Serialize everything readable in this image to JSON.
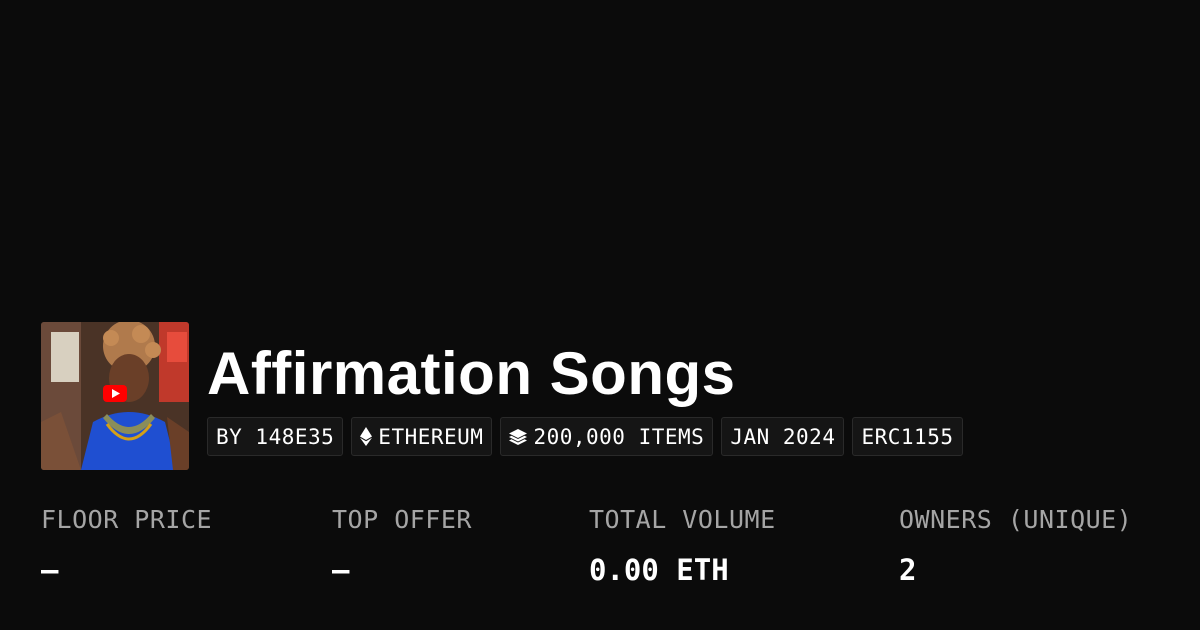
{
  "collection": {
    "title": "Affirmation Songs",
    "avatar_icon": "play-badge-icon",
    "tags": [
      {
        "label": "BY 148E35",
        "icon": null
      },
      {
        "label": "ETHEREUM",
        "icon": "ethereum-icon"
      },
      {
        "label": "200,000 ITEMS",
        "icon": "layers-icon"
      },
      {
        "label": "JAN 2024",
        "icon": null
      },
      {
        "label": "ERC1155",
        "icon": null
      }
    ]
  },
  "stats": [
    {
      "label": "FLOOR PRICE",
      "value": "–"
    },
    {
      "label": "TOP OFFER",
      "value": "–"
    },
    {
      "label": "TOTAL VOLUME",
      "value": "0.00 ETH"
    },
    {
      "label": "OWNERS (UNIQUE)",
      "value": "2"
    }
  ],
  "colors": {
    "background": "#0b0b0b",
    "text": "#ffffff",
    "muted": "#a5a5a5",
    "tag_bg": "#151515",
    "play_red": "#ff0000"
  }
}
